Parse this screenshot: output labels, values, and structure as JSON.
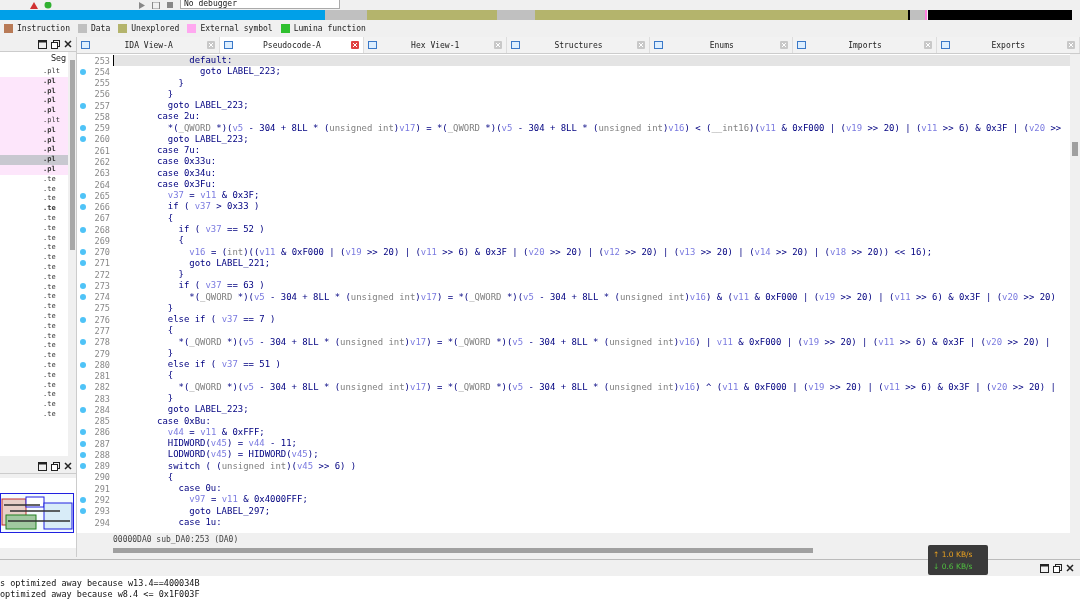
{
  "toolbar": {
    "debugger": "No debugger"
  },
  "legend": [
    {
      "label": "Instruction",
      "color": "#b87a56"
    },
    {
      "label": "Data",
      "color": "#c0c0c0"
    },
    {
      "label": "Unexplored",
      "color": "#b4b46c"
    },
    {
      "label": "External symbol",
      "color": "#ffa8f0"
    },
    {
      "label": "Lumina function",
      "color": "#30c030"
    }
  ],
  "functions_panel": {
    "column": "Seg",
    "rows": [
      {
        "text": ".plt",
        "external": false,
        "bold": false,
        "selected": false
      },
      {
        "text": ".pl",
        "external": true,
        "bold": true,
        "selected": false
      },
      {
        "text": ".pl",
        "external": true,
        "bold": true,
        "selected": false
      },
      {
        "text": ".pl",
        "external": true,
        "bold": true,
        "selected": false
      },
      {
        "text": ".pl",
        "external": true,
        "bold": true,
        "selected": false
      },
      {
        "text": ".plt",
        "external": true,
        "bold": false,
        "selected": false
      },
      {
        "text": ".pl",
        "external": true,
        "bold": true,
        "selected": false
      },
      {
        "text": ".pl",
        "external": true,
        "bold": true,
        "selected": false
      },
      {
        "text": ".pl",
        "external": true,
        "bold": true,
        "selected": false
      },
      {
        "text": ".pl",
        "external": true,
        "bold": true,
        "selected": true
      },
      {
        "text": ".pl",
        "external": true,
        "bold": true,
        "selected": false
      },
      {
        "text": ".te",
        "external": false,
        "bold": false,
        "selected": false
      },
      {
        "text": ".te",
        "external": false,
        "bold": false,
        "selected": false
      },
      {
        "text": ".te",
        "external": false,
        "bold": false,
        "selected": false
      },
      {
        "text": ".te",
        "external": false,
        "bold": true,
        "selected": false
      },
      {
        "text": ".te",
        "external": false,
        "bold": false,
        "selected": false
      },
      {
        "text": ".te",
        "external": false,
        "bold": false,
        "selected": false
      },
      {
        "text": ".te",
        "external": false,
        "bold": false,
        "selected": false
      },
      {
        "text": ".te",
        "external": false,
        "bold": false,
        "selected": false
      },
      {
        "text": ".te",
        "external": false,
        "bold": false,
        "selected": false
      },
      {
        "text": ".te",
        "external": false,
        "bold": false,
        "selected": false
      },
      {
        "text": ".te",
        "external": false,
        "bold": false,
        "selected": false
      },
      {
        "text": ".te",
        "external": false,
        "bold": false,
        "selected": false
      },
      {
        "text": ".te",
        "external": false,
        "bold": false,
        "selected": false
      },
      {
        "text": ".te",
        "external": false,
        "bold": false,
        "selected": false
      },
      {
        "text": ".te",
        "external": false,
        "bold": false,
        "selected": false
      },
      {
        "text": ".te",
        "external": false,
        "bold": false,
        "selected": false
      },
      {
        "text": ".te",
        "external": false,
        "bold": false,
        "selected": false
      },
      {
        "text": ".te",
        "external": false,
        "bold": false,
        "selected": false
      },
      {
        "text": ".te",
        "external": false,
        "bold": false,
        "selected": false
      },
      {
        "text": ".te",
        "external": false,
        "bold": false,
        "selected": false
      },
      {
        "text": ".te",
        "external": false,
        "bold": false,
        "selected": false
      },
      {
        "text": ".te",
        "external": false,
        "bold": false,
        "selected": false
      },
      {
        "text": ".te",
        "external": false,
        "bold": false,
        "selected": false
      },
      {
        "text": ".te",
        "external": false,
        "bold": false,
        "selected": false
      },
      {
        "text": ".te",
        "external": false,
        "bold": false,
        "selected": false
      }
    ]
  },
  "tabs": [
    {
      "label": "IDA View-A",
      "selected": false
    },
    {
      "label": "Pseudocode-A",
      "selected": true
    },
    {
      "label": "Hex View-1",
      "selected": false
    },
    {
      "label": "Structures",
      "selected": false
    },
    {
      "label": "Enums",
      "selected": false
    },
    {
      "label": "Imports",
      "selected": false
    },
    {
      "label": "Exports",
      "selected": false
    }
  ],
  "code": [
    {
      "number": "253",
      "text": "              default:",
      "marked": false,
      "current": true
    },
    {
      "number": "254",
      "text": "                goto LABEL_223;",
      "marked": true,
      "current": false
    },
    {
      "number": "255",
      "text": "            }",
      "marked": false,
      "current": false
    },
    {
      "number": "256",
      "text": "          }",
      "marked": false,
      "current": false
    },
    {
      "number": "257",
      "text": "          goto LABEL_223;",
      "marked": true,
      "current": false
    },
    {
      "number": "258",
      "text": "        case 2u:",
      "marked": false,
      "current": false
    },
    {
      "number": "259",
      "text": "          *(_QWORD *)(v5 - 304 + 8LL * (unsigned int)v17) = *(_QWORD *)(v5 - 304 + 8LL * (unsigned int)v16) < (__int16)(v11 & 0xF000 | (v19 >> 20) | (v11 >> 6) & 0x3F | (v20 >>",
      "marked": true,
      "current": false
    },
    {
      "number": "260",
      "text": "          goto LABEL_223;",
      "marked": true,
      "current": false
    },
    {
      "number": "261",
      "text": "        case 7u:",
      "marked": false,
      "current": false
    },
    {
      "number": "262",
      "text": "        case 0x33u:",
      "marked": false,
      "current": false
    },
    {
      "number": "263",
      "text": "        case 0x34u:",
      "marked": false,
      "current": false
    },
    {
      "number": "264",
      "text": "        case 0x3Fu:",
      "marked": false,
      "current": false
    },
    {
      "number": "265",
      "text": "          v37 = v11 & 0x3F;",
      "marked": true,
      "current": false
    },
    {
      "number": "266",
      "text": "          if ( v37 > 0x33 )",
      "marked": true,
      "current": false
    },
    {
      "number": "267",
      "text": "          {",
      "marked": false,
      "current": false
    },
    {
      "number": "268",
      "text": "            if ( v37 == 52 )",
      "marked": true,
      "current": false
    },
    {
      "number": "269",
      "text": "            {",
      "marked": false,
      "current": false
    },
    {
      "number": "270",
      "text": "              v16 = (int)((v11 & 0xF000 | (v19 >> 20) | (v11 >> 6) & 0x3F | (v20 >> 20) | (v12 >> 20) | (v13 >> 20) | (v14 >> 20) | (v18 >> 20)) << 16);",
      "marked": true,
      "current": false
    },
    {
      "number": "271",
      "text": "              goto LABEL_221;",
      "marked": true,
      "current": false
    },
    {
      "number": "272",
      "text": "            }",
      "marked": false,
      "current": false
    },
    {
      "number": "273",
      "text": "            if ( v37 == 63 )",
      "marked": true,
      "current": false
    },
    {
      "number": "274",
      "text": "              *(_QWORD *)(v5 - 304 + 8LL * (unsigned int)v17) = *(_QWORD *)(v5 - 304 + 8LL * (unsigned int)v16) & (v11 & 0xF000 | (v19 >> 20) | (v11 >> 6) & 0x3F | (v20 >> 20)",
      "marked": true,
      "current": false
    },
    {
      "number": "275",
      "text": "          }",
      "marked": false,
      "current": false
    },
    {
      "number": "276",
      "text": "          else if ( v37 == 7 )",
      "marked": true,
      "current": false
    },
    {
      "number": "277",
      "text": "          {",
      "marked": false,
      "current": false
    },
    {
      "number": "278",
      "text": "            *(_QWORD *)(v5 - 304 + 8LL * (unsigned int)v17) = *(_QWORD *)(v5 - 304 + 8LL * (unsigned int)v16) | v11 & 0xF000 | (v19 >> 20) | (v11 >> 6) & 0x3F | (v20 >> 20) |",
      "marked": true,
      "current": false
    },
    {
      "number": "279",
      "text": "          }",
      "marked": false,
      "current": false
    },
    {
      "number": "280",
      "text": "          else if ( v37 == 51 )",
      "marked": true,
      "current": false
    },
    {
      "number": "281",
      "text": "          {",
      "marked": false,
      "current": false
    },
    {
      "number": "282",
      "text": "            *(_QWORD *)(v5 - 304 + 8LL * (unsigned int)v17) = *(_QWORD *)(v5 - 304 + 8LL * (unsigned int)v16) ^ (v11 & 0xF000 | (v19 >> 20) | (v11 >> 6) & 0x3F | (v20 >> 20) |",
      "marked": true,
      "current": false
    },
    {
      "number": "283",
      "text": "          }",
      "marked": false,
      "current": false
    },
    {
      "number": "284",
      "text": "          goto LABEL_223;",
      "marked": true,
      "current": false
    },
    {
      "number": "285",
      "text": "        case 0xBu:",
      "marked": false,
      "current": false
    },
    {
      "number": "286",
      "text": "          v44 = v11 & 0xFFF;",
      "marked": true,
      "current": false
    },
    {
      "number": "287",
      "text": "          HIDWORD(v45) = v44 - 11;",
      "marked": true,
      "current": false
    },
    {
      "number": "288",
      "text": "          LODWORD(v45) = HIDWORD(v45);",
      "marked": true,
      "current": false
    },
    {
      "number": "289",
      "text": "          switch ( (unsigned int)(v45 >> 6) )",
      "marked": true,
      "current": false
    },
    {
      "number": "290",
      "text": "          {",
      "marked": false,
      "current": false
    },
    {
      "number": "291",
      "text": "            case 0u:",
      "marked": false,
      "current": false
    },
    {
      "number": "292",
      "text": "              v97 = v11 & 0x4000FFF;",
      "marked": true,
      "current": false
    },
    {
      "number": "293",
      "text": "              goto LABEL_297;",
      "marked": true,
      "current": false
    },
    {
      "number": "294",
      "text": "            case 1u:",
      "marked": false,
      "current": false
    }
  ],
  "status": {
    "location": "00000DA0 sub_DA0:253 (DA0)"
  },
  "network": {
    "upload": "↑ 1.0 KB/s",
    "download": "↓ 0.6 KB/s"
  },
  "output": [
    "s optimized away because w13.4==400034B",
    "optimized away because w8.4 <= 0x1F003F"
  ]
}
